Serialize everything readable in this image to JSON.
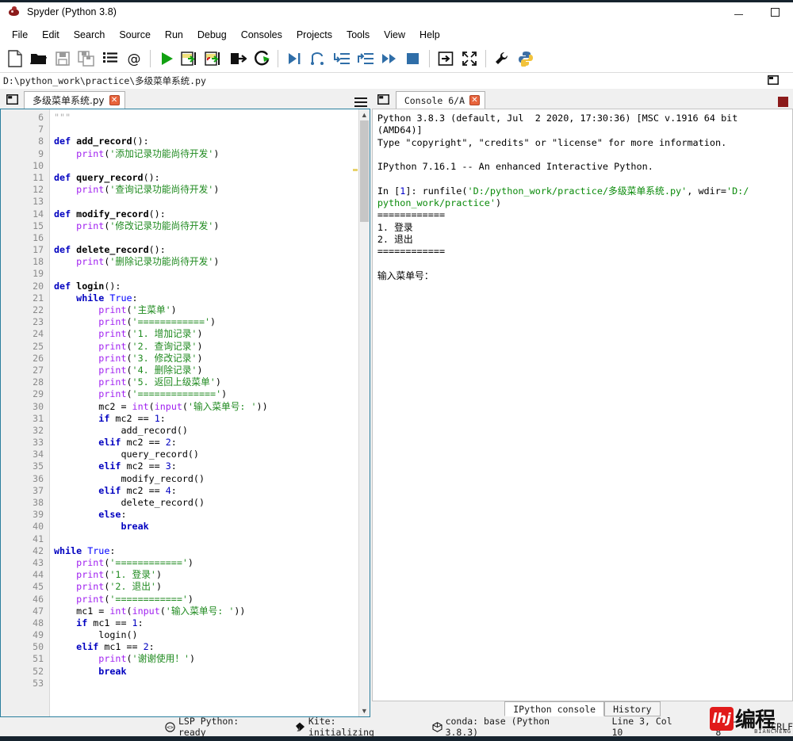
{
  "window": {
    "title": "Spyder (Python 3.8)",
    "icon": "spyder-icon",
    "minimize_label": "–",
    "maximize_label": "□"
  },
  "menubar": {
    "items": [
      {
        "label": "File",
        "name": "menu-file"
      },
      {
        "label": "Edit",
        "name": "menu-edit"
      },
      {
        "label": "Search",
        "name": "menu-search"
      },
      {
        "label": "Source",
        "name": "menu-source"
      },
      {
        "label": "Run",
        "name": "menu-run"
      },
      {
        "label": "Debug",
        "name": "menu-debug"
      },
      {
        "label": "Consoles",
        "name": "menu-consoles"
      },
      {
        "label": "Projects",
        "name": "menu-projects"
      },
      {
        "label": "Tools",
        "name": "menu-tools"
      },
      {
        "label": "View",
        "name": "menu-view"
      },
      {
        "label": "Help",
        "name": "menu-help"
      }
    ]
  },
  "toolbar": {
    "buttons": [
      {
        "name": "new-file-icon",
        "title": "New file"
      },
      {
        "name": "open-file-icon",
        "title": "Open file"
      },
      {
        "name": "save-file-icon",
        "title": "Save file"
      },
      {
        "name": "save-all-icon",
        "title": "Save all"
      },
      {
        "name": "file-switcher-icon",
        "title": "File switcher"
      },
      {
        "name": "find-symbols-icon",
        "title": "Find symbols"
      },
      {
        "name": "run-file-icon",
        "title": "Run file"
      },
      {
        "name": "run-cell-icon",
        "title": "Run cell"
      },
      {
        "name": "run-cell-advance-icon",
        "title": "Run cell and advance"
      },
      {
        "name": "run-selection-icon",
        "title": "Run selection"
      },
      {
        "name": "rerun-file-icon",
        "title": "Re-run last cell"
      },
      {
        "name": "debug-file-icon",
        "title": "Debug file"
      },
      {
        "name": "step-over-icon",
        "title": "Run current line"
      },
      {
        "name": "step-into-icon",
        "title": "Step into function"
      },
      {
        "name": "step-return-icon",
        "title": "Run until return"
      },
      {
        "name": "continue-icon",
        "title": "Continue execution"
      },
      {
        "name": "stop-debug-icon",
        "title": "Stop debugging"
      },
      {
        "name": "maximize-pane-icon",
        "title": "Maximize current pane"
      },
      {
        "name": "fullscreen-icon",
        "title": "Fullscreen mode"
      },
      {
        "name": "preferences-icon",
        "title": "Preferences"
      },
      {
        "name": "pythonpath-icon",
        "title": "PYTHONPATH manager"
      }
    ]
  },
  "pathbar": {
    "path": "D:\\python_work\\practice\\多级菜单系统.py"
  },
  "editor": {
    "tab_label": "多级菜单系统.py",
    "tab_close": "✕",
    "first_line": 6,
    "lines": [
      {
        "n": 6,
        "tokens": [
          {
            "t": "\"\"\"",
            "c": "cmt"
          }
        ],
        "indent": 0
      },
      {
        "n": 7,
        "tokens": [],
        "indent": 0
      },
      {
        "n": 8,
        "tokens": [
          {
            "t": "def ",
            "c": "kw"
          },
          {
            "t": "add_record",
            "c": "fn"
          },
          {
            "t": "():",
            "c": "op"
          }
        ],
        "indent": 0
      },
      {
        "n": 9,
        "tokens": [
          {
            "t": "print",
            "c": "bi"
          },
          {
            "t": "(",
            "c": "op"
          },
          {
            "t": "'添加记录功能尚待开发'",
            "c": "str"
          },
          {
            "t": ")",
            "c": "op"
          }
        ],
        "indent": 1
      },
      {
        "n": 10,
        "tokens": [],
        "indent": 0
      },
      {
        "n": 11,
        "tokens": [
          {
            "t": "def ",
            "c": "kw"
          },
          {
            "t": "query_record",
            "c": "fn"
          },
          {
            "t": "():",
            "c": "op"
          }
        ],
        "indent": 0
      },
      {
        "n": 12,
        "tokens": [
          {
            "t": "print",
            "c": "bi"
          },
          {
            "t": "(",
            "c": "op"
          },
          {
            "t": "'查询记录功能尚待开发'",
            "c": "str"
          },
          {
            "t": ")",
            "c": "op"
          }
        ],
        "indent": 1
      },
      {
        "n": 13,
        "tokens": [],
        "indent": 0
      },
      {
        "n": 14,
        "tokens": [
          {
            "t": "def ",
            "c": "kw"
          },
          {
            "t": "modify_record",
            "c": "fn"
          },
          {
            "t": "():",
            "c": "op"
          }
        ],
        "indent": 0
      },
      {
        "n": 15,
        "tokens": [
          {
            "t": "print",
            "c": "bi"
          },
          {
            "t": "(",
            "c": "op"
          },
          {
            "t": "'修改记录功能尚待开发'",
            "c": "str"
          },
          {
            "t": ")",
            "c": "op"
          }
        ],
        "indent": 1
      },
      {
        "n": 16,
        "tokens": [],
        "indent": 0
      },
      {
        "n": 17,
        "tokens": [
          {
            "t": "def ",
            "c": "kw"
          },
          {
            "t": "delete_record",
            "c": "fn"
          },
          {
            "t": "():",
            "c": "op"
          }
        ],
        "indent": 0
      },
      {
        "n": 18,
        "tokens": [
          {
            "t": "print",
            "c": "bi"
          },
          {
            "t": "(",
            "c": "op"
          },
          {
            "t": "'删除记录功能尚待开发'",
            "c": "str"
          },
          {
            "t": ")",
            "c": "op"
          }
        ],
        "indent": 1
      },
      {
        "n": 19,
        "tokens": [],
        "indent": 0
      },
      {
        "n": 20,
        "tokens": [
          {
            "t": "def ",
            "c": "kw"
          },
          {
            "t": "login",
            "c": "fn"
          },
          {
            "t": "():",
            "c": "op"
          }
        ],
        "indent": 0
      },
      {
        "n": 21,
        "tokens": [
          {
            "t": "while ",
            "c": "kw"
          },
          {
            "t": "True",
            "c": "kw2"
          },
          {
            "t": ":",
            "c": "op"
          }
        ],
        "indent": 1
      },
      {
        "n": 22,
        "tokens": [
          {
            "t": "print",
            "c": "bi"
          },
          {
            "t": "(",
            "c": "op"
          },
          {
            "t": "'主菜单'",
            "c": "str"
          },
          {
            "t": ")",
            "c": "op"
          }
        ],
        "indent": 2
      },
      {
        "n": 23,
        "tokens": [
          {
            "t": "print",
            "c": "bi"
          },
          {
            "t": "(",
            "c": "op"
          },
          {
            "t": "'============'",
            "c": "str"
          },
          {
            "t": ")",
            "c": "op"
          }
        ],
        "indent": 2
      },
      {
        "n": 24,
        "tokens": [
          {
            "t": "print",
            "c": "bi"
          },
          {
            "t": "(",
            "c": "op"
          },
          {
            "t": "'1. 增加记录'",
            "c": "str"
          },
          {
            "t": ")",
            "c": "op"
          }
        ],
        "indent": 2
      },
      {
        "n": 25,
        "tokens": [
          {
            "t": "print",
            "c": "bi"
          },
          {
            "t": "(",
            "c": "op"
          },
          {
            "t": "'2. 查询记录'",
            "c": "str"
          },
          {
            "t": ")",
            "c": "op"
          }
        ],
        "indent": 2
      },
      {
        "n": 26,
        "tokens": [
          {
            "t": "print",
            "c": "bi"
          },
          {
            "t": "(",
            "c": "op"
          },
          {
            "t": "'3. 修改记录'",
            "c": "str"
          },
          {
            "t": ")",
            "c": "op"
          }
        ],
        "indent": 2
      },
      {
        "n": 27,
        "tokens": [
          {
            "t": "print",
            "c": "bi"
          },
          {
            "t": "(",
            "c": "op"
          },
          {
            "t": "'4. 删除记录'",
            "c": "str"
          },
          {
            "t": ")",
            "c": "op"
          }
        ],
        "indent": 2
      },
      {
        "n": 28,
        "tokens": [
          {
            "t": "print",
            "c": "bi"
          },
          {
            "t": "(",
            "c": "op"
          },
          {
            "t": "'5. 返回上级菜单'",
            "c": "str"
          },
          {
            "t": ")",
            "c": "op"
          }
        ],
        "indent": 2
      },
      {
        "n": 29,
        "tokens": [
          {
            "t": "print",
            "c": "bi"
          },
          {
            "t": "(",
            "c": "op"
          },
          {
            "t": "'=============='",
            "c": "str"
          },
          {
            "t": ")",
            "c": "op"
          }
        ],
        "indent": 2
      },
      {
        "n": 30,
        "tokens": [
          {
            "t": "mc2 = ",
            "c": "op"
          },
          {
            "t": "int",
            "c": "bi"
          },
          {
            "t": "(",
            "c": "op"
          },
          {
            "t": "input",
            "c": "bi"
          },
          {
            "t": "(",
            "c": "op"
          },
          {
            "t": "'输入菜单号: '",
            "c": "str"
          },
          {
            "t": "))",
            "c": "op"
          }
        ],
        "indent": 2
      },
      {
        "n": 31,
        "tokens": [
          {
            "t": "if ",
            "c": "kw"
          },
          {
            "t": "mc2 == ",
            "c": "op"
          },
          {
            "t": "1",
            "c": "num"
          },
          {
            "t": ":",
            "c": "op"
          }
        ],
        "indent": 2
      },
      {
        "n": 32,
        "tokens": [
          {
            "t": "add_record()",
            "c": "op"
          }
        ],
        "indent": 3
      },
      {
        "n": 33,
        "tokens": [
          {
            "t": "elif ",
            "c": "kw"
          },
          {
            "t": "mc2 == ",
            "c": "op"
          },
          {
            "t": "2",
            "c": "num"
          },
          {
            "t": ":",
            "c": "op"
          }
        ],
        "indent": 2
      },
      {
        "n": 34,
        "tokens": [
          {
            "t": "query_record()",
            "c": "op"
          }
        ],
        "indent": 3
      },
      {
        "n": 35,
        "tokens": [
          {
            "t": "elif ",
            "c": "kw"
          },
          {
            "t": "mc2 == ",
            "c": "op"
          },
          {
            "t": "3",
            "c": "num"
          },
          {
            "t": ":",
            "c": "op"
          }
        ],
        "indent": 2
      },
      {
        "n": 36,
        "tokens": [
          {
            "t": "modify_record()",
            "c": "op"
          }
        ],
        "indent": 3
      },
      {
        "n": 37,
        "tokens": [
          {
            "t": "elif ",
            "c": "kw"
          },
          {
            "t": "mc2 == ",
            "c": "op"
          },
          {
            "t": "4",
            "c": "num"
          },
          {
            "t": ":",
            "c": "op"
          }
        ],
        "indent": 2
      },
      {
        "n": 38,
        "tokens": [
          {
            "t": "delete_record()",
            "c": "op"
          }
        ],
        "indent": 3
      },
      {
        "n": 39,
        "tokens": [
          {
            "t": "else",
            "c": "kw"
          },
          {
            "t": ":",
            "c": "op"
          }
        ],
        "indent": 2
      },
      {
        "n": 40,
        "tokens": [
          {
            "t": "break",
            "c": "kw"
          }
        ],
        "indent": 3
      },
      {
        "n": 41,
        "tokens": [],
        "indent": 0
      },
      {
        "n": 42,
        "tokens": [
          {
            "t": "while ",
            "c": "kw"
          },
          {
            "t": "True",
            "c": "kw2"
          },
          {
            "t": ":",
            "c": "op"
          }
        ],
        "indent": 0
      },
      {
        "n": 43,
        "tokens": [
          {
            "t": "print",
            "c": "bi"
          },
          {
            "t": "(",
            "c": "op"
          },
          {
            "t": "'============'",
            "c": "str"
          },
          {
            "t": ")",
            "c": "op"
          }
        ],
        "indent": 1
      },
      {
        "n": 44,
        "tokens": [
          {
            "t": "print",
            "c": "bi"
          },
          {
            "t": "(",
            "c": "op"
          },
          {
            "t": "'1. 登录'",
            "c": "str"
          },
          {
            "t": ")",
            "c": "op"
          }
        ],
        "indent": 1
      },
      {
        "n": 45,
        "tokens": [
          {
            "t": "print",
            "c": "bi"
          },
          {
            "t": "(",
            "c": "op"
          },
          {
            "t": "'2. 退出'",
            "c": "str"
          },
          {
            "t": ")",
            "c": "op"
          }
        ],
        "indent": 1
      },
      {
        "n": 46,
        "tokens": [
          {
            "t": "print",
            "c": "bi"
          },
          {
            "t": "(",
            "c": "op"
          },
          {
            "t": "'============'",
            "c": "str"
          },
          {
            "t": ")",
            "c": "op"
          }
        ],
        "indent": 1
      },
      {
        "n": 47,
        "tokens": [
          {
            "t": "mc1 = ",
            "c": "op"
          },
          {
            "t": "int",
            "c": "bi"
          },
          {
            "t": "(",
            "c": "op"
          },
          {
            "t": "input",
            "c": "bi"
          },
          {
            "t": "(",
            "c": "op"
          },
          {
            "t": "'输入菜单号: '",
            "c": "str"
          },
          {
            "t": "))",
            "c": "op"
          }
        ],
        "indent": 1
      },
      {
        "n": 48,
        "tokens": [
          {
            "t": "if ",
            "c": "kw"
          },
          {
            "t": "mc1 == ",
            "c": "op"
          },
          {
            "t": "1",
            "c": "num"
          },
          {
            "t": ":",
            "c": "op"
          }
        ],
        "indent": 1
      },
      {
        "n": 49,
        "tokens": [
          {
            "t": "login()",
            "c": "op"
          }
        ],
        "indent": 2
      },
      {
        "n": 50,
        "tokens": [
          {
            "t": "elif ",
            "c": "kw"
          },
          {
            "t": "mc1 == ",
            "c": "op"
          },
          {
            "t": "2",
            "c": "num"
          },
          {
            "t": ":",
            "c": "op"
          }
        ],
        "indent": 1
      },
      {
        "n": 51,
        "tokens": [
          {
            "t": "print",
            "c": "bi"
          },
          {
            "t": "(",
            "c": "op"
          },
          {
            "t": "'谢谢使用！'",
            "c": "str"
          },
          {
            "t": ")",
            "c": "op"
          }
        ],
        "indent": 2
      },
      {
        "n": 52,
        "tokens": [
          {
            "t": "break",
            "c": "kw"
          }
        ],
        "indent": 2
      },
      {
        "n": 53,
        "tokens": [],
        "indent": 0
      }
    ]
  },
  "console": {
    "tab_label": "Console 6/A",
    "tab_close": "✕",
    "lines": [
      {
        "segs": [
          {
            "t": "Python 3.8.3 (default, Jul  2 2020, 17:30:36) [MSC v.1916 64 bit (AMD64)]",
            "c": ""
          }
        ]
      },
      {
        "segs": [
          {
            "t": "Type \"copyright\", \"credits\" or \"license\" for more information.",
            "c": ""
          }
        ]
      },
      {
        "segs": [
          {
            "t": "",
            "c": ""
          }
        ]
      },
      {
        "segs": [
          {
            "t": "IPython 7.16.1 -- An enhanced Interactive Python.",
            "c": ""
          }
        ]
      },
      {
        "segs": [
          {
            "t": "",
            "c": ""
          }
        ]
      },
      {
        "segs": [
          {
            "t": "In [",
            "c": ""
          },
          {
            "t": "1",
            "c": "con-blue"
          },
          {
            "t": "]: runfile(",
            "c": ""
          },
          {
            "t": "'D:/python_work/practice/多级菜单系统.py'",
            "c": "con-green"
          },
          {
            "t": ", wdir=",
            "c": ""
          },
          {
            "t": "'D:/",
            "c": "con-green"
          }
        ]
      },
      {
        "segs": [
          {
            "t": "python_work/practice'",
            "c": "con-green"
          },
          {
            "t": ")",
            "c": ""
          }
        ]
      },
      {
        "segs": [
          {
            "t": "============",
            "c": ""
          }
        ]
      },
      {
        "segs": [
          {
            "t": "1. 登录",
            "c": ""
          }
        ]
      },
      {
        "segs": [
          {
            "t": "2. 退出",
            "c": ""
          }
        ]
      },
      {
        "segs": [
          {
            "t": "============",
            "c": ""
          }
        ]
      },
      {
        "segs": [
          {
            "t": "",
            "c": ""
          }
        ]
      },
      {
        "segs": [
          {
            "t": "输入菜单号：",
            "c": ""
          }
        ]
      }
    ],
    "bottom_tabs": [
      {
        "label": "IPython console",
        "active": true,
        "name": "tab-ipython-console"
      },
      {
        "label": "History",
        "active": false,
        "name": "tab-history"
      }
    ]
  },
  "statusbar": {
    "lsp": "LSP Python: ready",
    "kite": "Kite: initializing",
    "conda": "conda: base (Python 3.8.3)",
    "cursor": "Line 3, Col 10",
    "encoding": "UTF-8",
    "eol": "CRLF"
  },
  "watermark": {
    "badge": "lhj",
    "text": "编程",
    "sub": "BIANCHENG"
  },
  "colors": {
    "accent_blue": "#2a7f9e",
    "title_dark": "#16232e",
    "string_green": "#1f8a1f",
    "keyword_blue": "#0000c0",
    "builtin_purple": "#a020f0",
    "close_orange": "#e8643c",
    "watermark_red": "#e11b1b"
  }
}
